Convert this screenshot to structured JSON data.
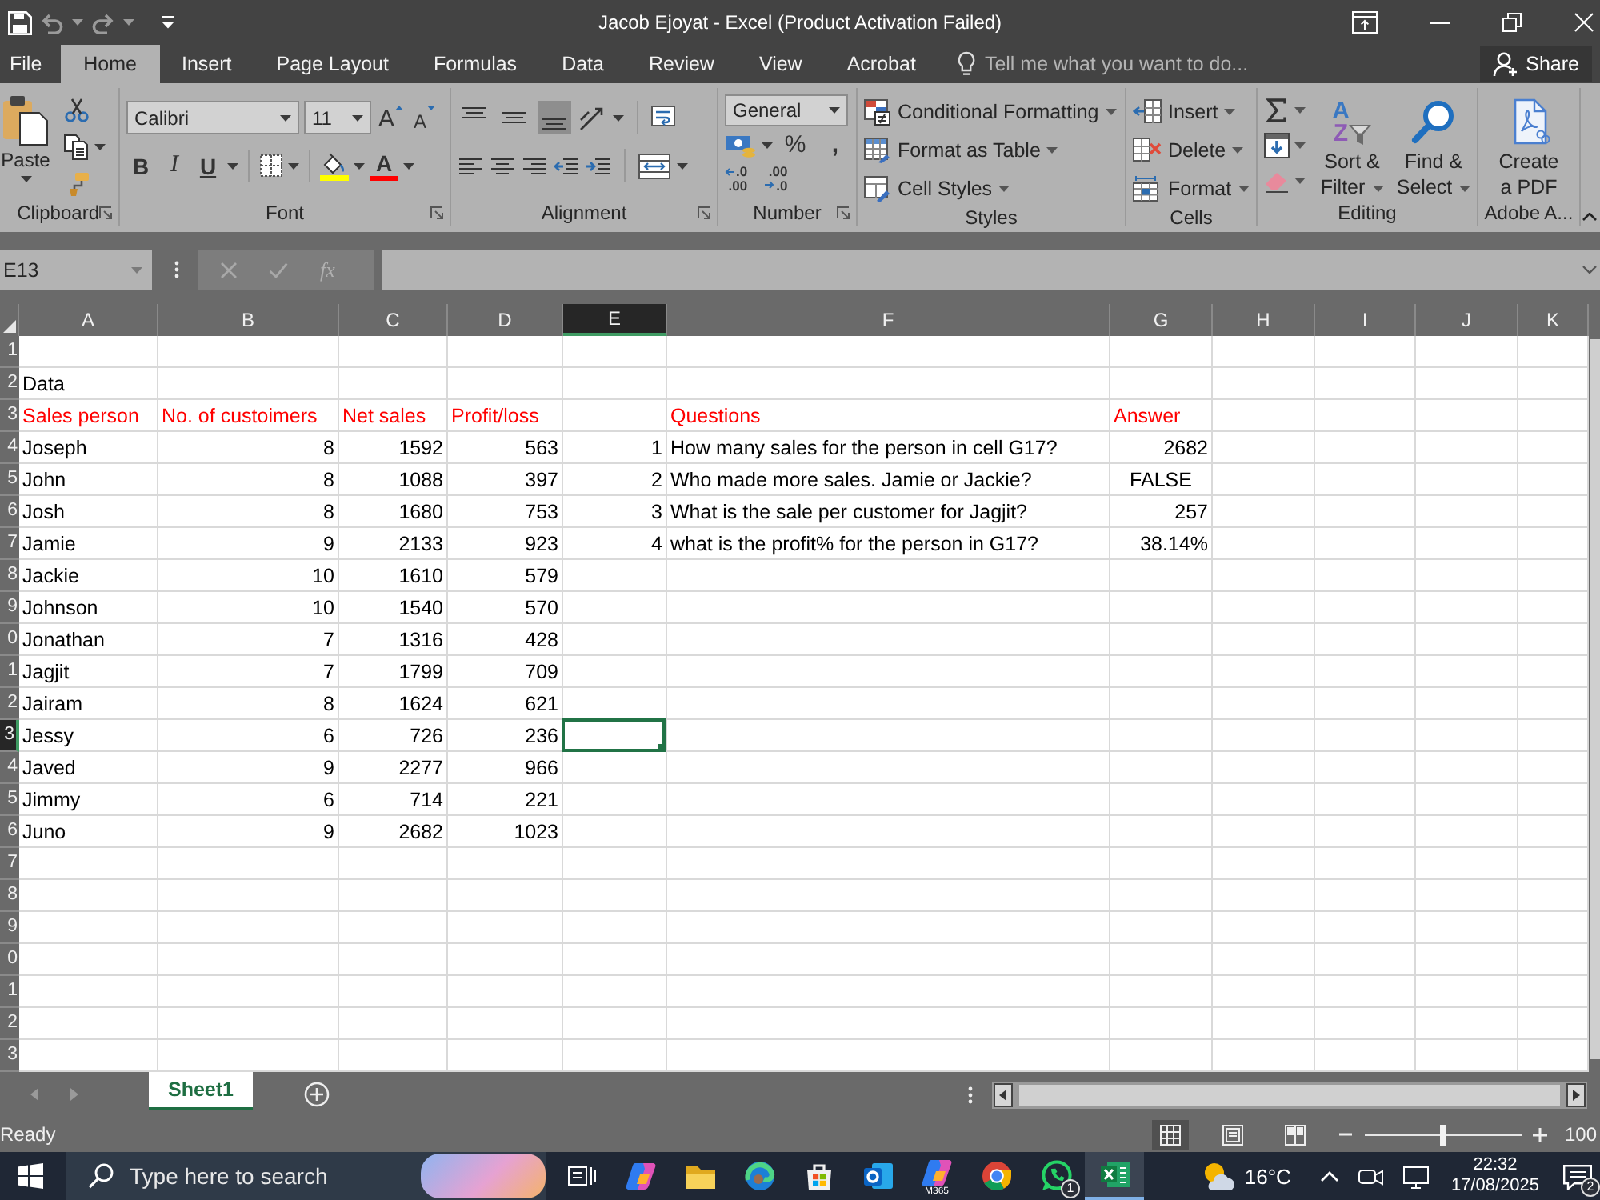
{
  "window": {
    "title": "Jacob Ejoyat - Excel (Product Activation Failed)"
  },
  "tabs": [
    {
      "label": "File",
      "selected": false
    },
    {
      "label": "Home",
      "selected": true
    },
    {
      "label": "Insert",
      "selected": false
    },
    {
      "label": "Page Layout",
      "selected": false
    },
    {
      "label": "Formulas",
      "selected": false
    },
    {
      "label": "Data",
      "selected": false
    },
    {
      "label": "Review",
      "selected": false
    },
    {
      "label": "View",
      "selected": false
    },
    {
      "label": "Acrobat",
      "selected": false
    }
  ],
  "tell_me": {
    "placeholder": "Tell me what you want to do..."
  },
  "share": {
    "label": "Share"
  },
  "ribbon": [
    {
      "kind": "clipboard",
      "label": "Clipboard",
      "paste": "Paste"
    },
    {
      "kind": "font",
      "label": "Font",
      "font_name": "Calibri",
      "font_size": "11",
      "grow": "A",
      "shrink": "A",
      "bold": "B",
      "italic": "I",
      "underline": "U",
      "font_color": "A"
    },
    {
      "kind": "alignment",
      "label": "Alignment",
      "vertical": [
        {
          "kind": "top",
          "selected": false
        },
        {
          "kind": "middle",
          "selected": false
        },
        {
          "kind": "bottom",
          "selected": true
        }
      ]
    },
    {
      "kind": "number",
      "label": "Number",
      "format": "General",
      "percent": "%",
      "comma": ",",
      "increase_decimal": [
        ".0",
        ".00"
      ],
      "decrease_decimal": [
        ".00",
        ".0"
      ]
    },
    {
      "kind": "styles",
      "label": "Styles",
      "commands": [
        {
          "kind": "conditional",
          "label": "Conditional Formatting"
        },
        {
          "kind": "table",
          "label": "Format as Table"
        },
        {
          "kind": "cell_styles",
          "label": "Cell Styles"
        }
      ]
    },
    {
      "kind": "cells",
      "label": "Cells",
      "commands": [
        {
          "kind": "insert",
          "label": "Insert"
        },
        {
          "kind": "delete",
          "label": "Delete"
        },
        {
          "kind": "format",
          "label": "Format"
        }
      ]
    },
    {
      "kind": "editing",
      "label": "Editing",
      "sort_letters": [
        "A",
        "Z"
      ],
      "commands": [
        {
          "kind": "sort",
          "label": "Sort & Filter"
        },
        {
          "kind": "find",
          "label": "Find & Select"
        }
      ]
    },
    {
      "kind": "adobe",
      "label": "Adobe A...",
      "command": "Create a PDF"
    }
  ],
  "formula_bar": {
    "name_box": "E13",
    "function": "fx"
  },
  "sheet": {
    "columns": [
      {
        "label": "A",
        "selected": false
      },
      {
        "label": "B",
        "selected": false
      },
      {
        "label": "C",
        "selected": false
      },
      {
        "label": "D",
        "selected": false
      },
      {
        "label": "E",
        "selected": true
      },
      {
        "label": "F",
        "selected": false
      },
      {
        "label": "G",
        "selected": false
      },
      {
        "label": "H",
        "selected": false
      },
      {
        "label": "I",
        "selected": false
      },
      {
        "label": "J",
        "selected": false
      },
      {
        "label": "K",
        "selected": false
      }
    ],
    "rows": [
      {
        "number": "1",
        "selected": false
      },
      {
        "number": "2",
        "selected": false,
        "cells": [
          {
            "kind": "text",
            "text": "Data"
          }
        ]
      },
      {
        "number": "3",
        "selected": false,
        "cells": [
          {
            "kind": "heading",
            "text": "Sales person"
          },
          {
            "kind": "heading",
            "text": "No. of custoimers"
          },
          {
            "kind": "heading",
            "text": "Net sales"
          },
          {
            "kind": "heading",
            "text": "Profit/loss"
          },
          null,
          {
            "kind": "heading",
            "text": "Questions"
          },
          {
            "kind": "heading",
            "text": "Answer"
          }
        ]
      },
      {
        "number": "4",
        "selected": false,
        "cells": [
          {
            "kind": "text",
            "text": "Joseph"
          },
          {
            "kind": "number",
            "text": "8"
          },
          {
            "kind": "number",
            "text": "1592"
          },
          {
            "kind": "number",
            "text": "563"
          },
          {
            "kind": "number",
            "text": "1"
          },
          {
            "kind": "text",
            "text": "How many sales for the person in cell G17?"
          },
          {
            "kind": "number",
            "text": "2682"
          }
        ]
      },
      {
        "number": "5",
        "selected": false,
        "cells": [
          {
            "kind": "text",
            "text": "John"
          },
          {
            "kind": "number",
            "text": "8"
          },
          {
            "kind": "number",
            "text": "1088"
          },
          {
            "kind": "number",
            "text": "397"
          },
          {
            "kind": "number",
            "text": "2"
          },
          {
            "kind": "text",
            "text": "Who made more sales. Jamie or Jackie?"
          },
          {
            "kind": "boolean",
            "text": "FALSE"
          }
        ]
      },
      {
        "number": "6",
        "selected": false,
        "cells": [
          {
            "kind": "text",
            "text": "Josh"
          },
          {
            "kind": "number",
            "text": "8"
          },
          {
            "kind": "number",
            "text": "1680"
          },
          {
            "kind": "number",
            "text": "753"
          },
          {
            "kind": "number",
            "text": "3"
          },
          {
            "kind": "text",
            "text": "What is the sale per customer for Jagjit?"
          },
          {
            "kind": "number",
            "text": "257"
          }
        ]
      },
      {
        "number": "7",
        "selected": false,
        "cells": [
          {
            "kind": "text",
            "text": "Jamie"
          },
          {
            "kind": "number",
            "text": "9"
          },
          {
            "kind": "number",
            "text": "2133"
          },
          {
            "kind": "number",
            "text": "923"
          },
          {
            "kind": "number",
            "text": "4"
          },
          {
            "kind": "text",
            "text": "what is the profit% for the person in G17?"
          },
          {
            "kind": "number",
            "text": "38.14%"
          }
        ]
      },
      {
        "number": "8",
        "selected": false,
        "cells": [
          {
            "kind": "text",
            "text": "Jackie"
          },
          {
            "kind": "number",
            "text": "10"
          },
          {
            "kind": "number",
            "text": "1610"
          },
          {
            "kind": "number",
            "text": "579"
          }
        ]
      },
      {
        "number": "9",
        "selected": false,
        "cells": [
          {
            "kind": "text",
            "text": "Johnson"
          },
          {
            "kind": "number",
            "text": "10"
          },
          {
            "kind": "number",
            "text": "1540"
          },
          {
            "kind": "number",
            "text": "570"
          }
        ]
      },
      {
        "number": "0",
        "selected": false,
        "cells": [
          {
            "kind": "text",
            "text": "Jonathan"
          },
          {
            "kind": "number",
            "text": "7"
          },
          {
            "kind": "number",
            "text": "1316"
          },
          {
            "kind": "number",
            "text": "428"
          }
        ]
      },
      {
        "number": "1",
        "selected": false,
        "cells": [
          {
            "kind": "text",
            "text": "Jagjit"
          },
          {
            "kind": "number",
            "text": "7"
          },
          {
            "kind": "number",
            "text": "1799"
          },
          {
            "kind": "number",
            "text": "709"
          }
        ]
      },
      {
        "number": "2",
        "selected": false,
        "cells": [
          {
            "kind": "text",
            "text": "Jairam"
          },
          {
            "kind": "number",
            "text": "8"
          },
          {
            "kind": "number",
            "text": "1624"
          },
          {
            "kind": "number",
            "text": "621"
          }
        ]
      },
      {
        "number": "3",
        "selected": true,
        "cells": [
          {
            "kind": "text",
            "text": "Jessy"
          },
          {
            "kind": "number",
            "text": "6"
          },
          {
            "kind": "number",
            "text": "726"
          },
          {
            "kind": "number",
            "text": "236"
          }
        ]
      },
      {
        "number": "4",
        "selected": false,
        "cells": [
          {
            "kind": "text",
            "text": "Javed"
          },
          {
            "kind": "number",
            "text": "9"
          },
          {
            "kind": "number",
            "text": "2277"
          },
          {
            "kind": "number",
            "text": "966"
          }
        ]
      },
      {
        "number": "5",
        "selected": false,
        "cells": [
          {
            "kind": "text",
            "text": "Jimmy"
          },
          {
            "kind": "number",
            "text": "6"
          },
          {
            "kind": "number",
            "text": "714"
          },
          {
            "kind": "number",
            "text": "221"
          }
        ]
      },
      {
        "number": "6",
        "selected": false,
        "cells": [
          {
            "kind": "text",
            "text": "Juno"
          },
          {
            "kind": "number",
            "text": "9"
          },
          {
            "kind": "number",
            "text": "2682"
          },
          {
            "kind": "number",
            "text": "1023"
          }
        ]
      },
      {
        "number": "7",
        "selected": false
      },
      {
        "number": "8",
        "selected": false
      },
      {
        "number": "9",
        "selected": false
      },
      {
        "number": "0",
        "selected": false
      },
      {
        "number": "1",
        "selected": false
      },
      {
        "number": "2",
        "selected": false
      },
      {
        "number": "3",
        "selected": false
      }
    ]
  },
  "sheet_tabs": [
    {
      "label": "Sheet1",
      "selected": true
    }
  ],
  "status_bar": {
    "status": "Ready",
    "views": [
      {
        "kind": "normal",
        "selected": true
      },
      {
        "kind": "page_layout",
        "selected": false
      },
      {
        "kind": "page_break",
        "selected": false
      }
    ],
    "zoom": {
      "level": 0.5,
      "reading": "100"
    }
  },
  "taskbar": {
    "search": {
      "placeholder": "Type here to search"
    },
    "apps": [
      {
        "kind": "task_view",
        "selected": false
      },
      {
        "kind": "sparkle",
        "selected": false
      },
      {
        "kind": "folder",
        "selected": false
      },
      {
        "kind": "swirl",
        "selected": false
      },
      {
        "kind": "bag",
        "selected": false
      },
      {
        "kind": "mail",
        "selected": false
      },
      {
        "kind": "sparkle",
        "label": "M365",
        "selected": false
      },
      {
        "kind": "ring",
        "selected": false
      },
      {
        "kind": "chat",
        "badge": "1",
        "selected": false
      },
      {
        "kind": "sheet",
        "selected": true
      }
    ],
    "weather": "16°C",
    "clock": {
      "time": "22:32",
      "date": "17/08/2025"
    },
    "notifications": "2"
  }
}
